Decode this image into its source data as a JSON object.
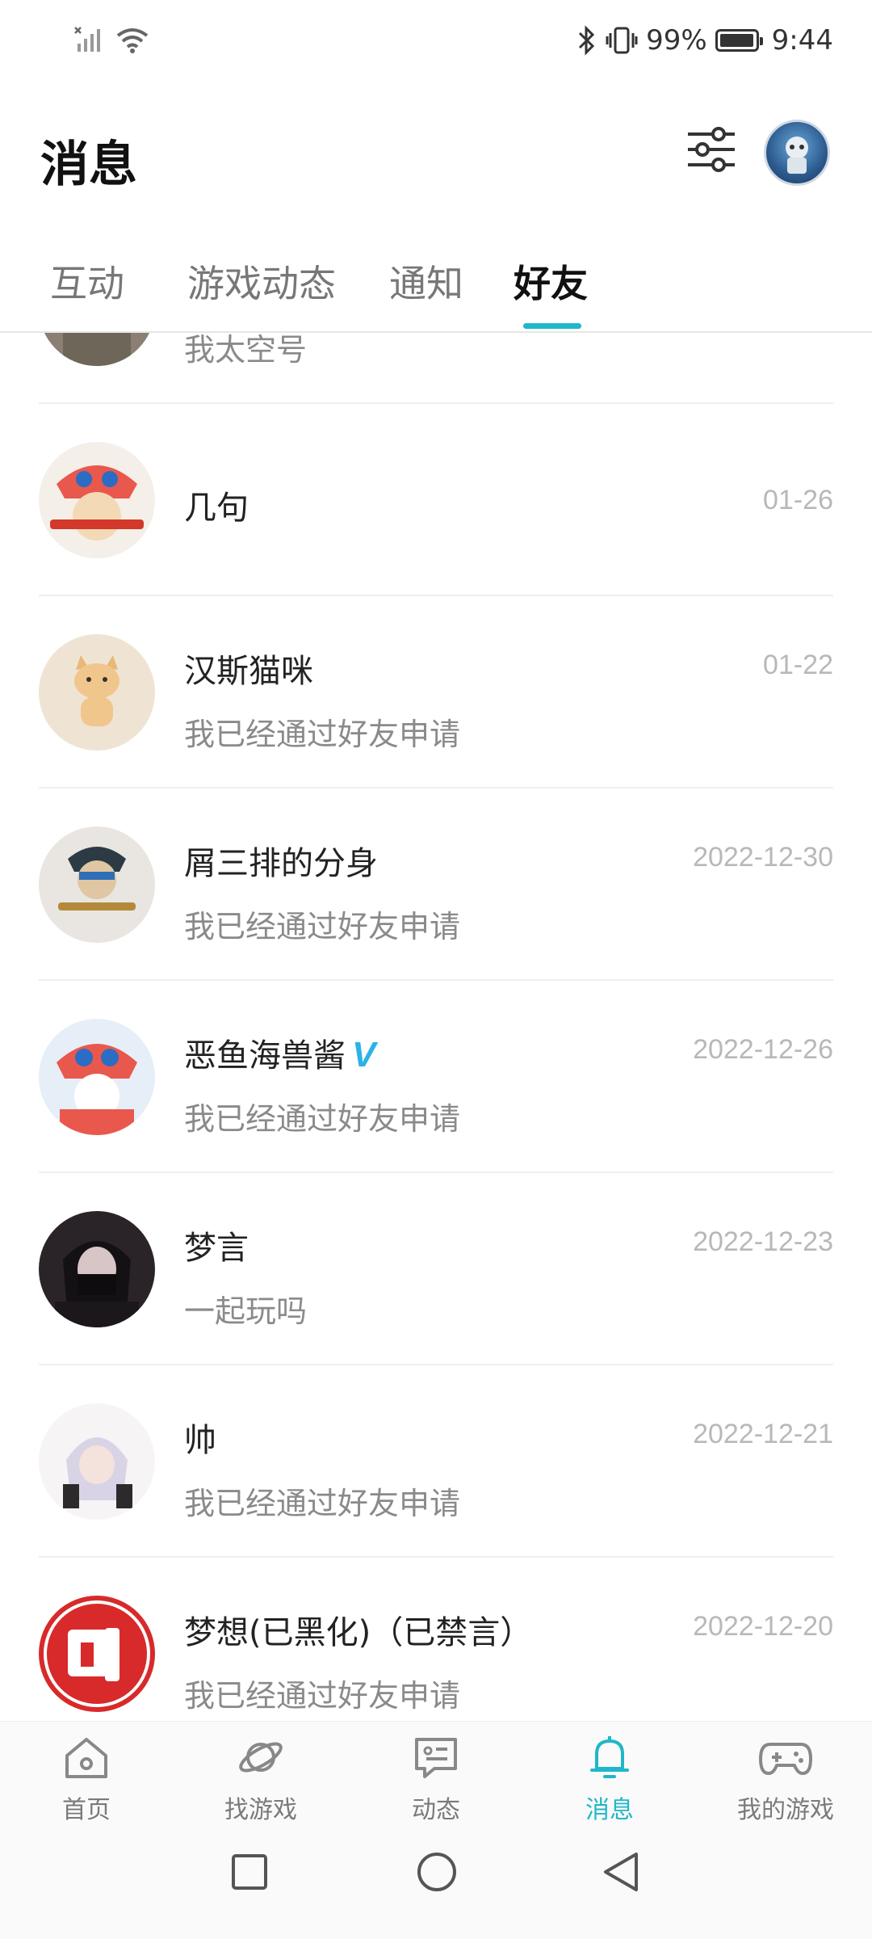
{
  "status_bar": {
    "battery": "99%",
    "battery_level": 0.99,
    "time": "9:44",
    "icons": [
      "no-sim-signal-icon",
      "wifi-icon",
      "bluetooth-icon",
      "vibrate-icon",
      "battery-icon"
    ]
  },
  "header": {
    "title": "消息",
    "filter_icon": "sliders-icon"
  },
  "tabs": [
    {
      "label": "互动",
      "active": false
    },
    {
      "label": "游戏动态",
      "active": false
    },
    {
      "label": "通知",
      "active": false
    },
    {
      "label": "好友",
      "active": true
    }
  ],
  "accent_color": "#20b7c8",
  "conversations": [
    {
      "name": "",
      "message": "我太空号",
      "time": ""
    },
    {
      "name": "几句",
      "message": "",
      "time": "01-26"
    },
    {
      "name": "汉斯猫咪",
      "message": "我已经通过好友申请",
      "time": "01-22"
    },
    {
      "name": "屑三排的分身",
      "message": "我已经通过好友申请",
      "time": "2022-12-30"
    },
    {
      "name": "恶鱼海兽酱",
      "verified_badge": "V",
      "message": "我已经通过好友申请",
      "time": "2022-12-26"
    },
    {
      "name": "梦言",
      "message": "一起玩吗",
      "time": "2022-12-23"
    },
    {
      "name": "帅",
      "message": "我已经通过好友申请",
      "time": "2022-12-21"
    },
    {
      "name": "梦想(已黑化)（已禁言）",
      "message": "我已经通过好友申请",
      "time": "2022-12-20"
    }
  ],
  "bottom_nav": [
    {
      "label": "首页",
      "icon": "home-icon",
      "active": false
    },
    {
      "label": "找游戏",
      "icon": "planet-icon",
      "active": false
    },
    {
      "label": "动态",
      "icon": "feed-icon",
      "active": false
    },
    {
      "label": "消息",
      "icon": "bell-icon",
      "active": true
    },
    {
      "label": "我的游戏",
      "icon": "gamepad-icon",
      "active": false
    }
  ],
  "system_nav": [
    "recent-apps-icon",
    "home-circle-icon",
    "back-icon"
  ]
}
